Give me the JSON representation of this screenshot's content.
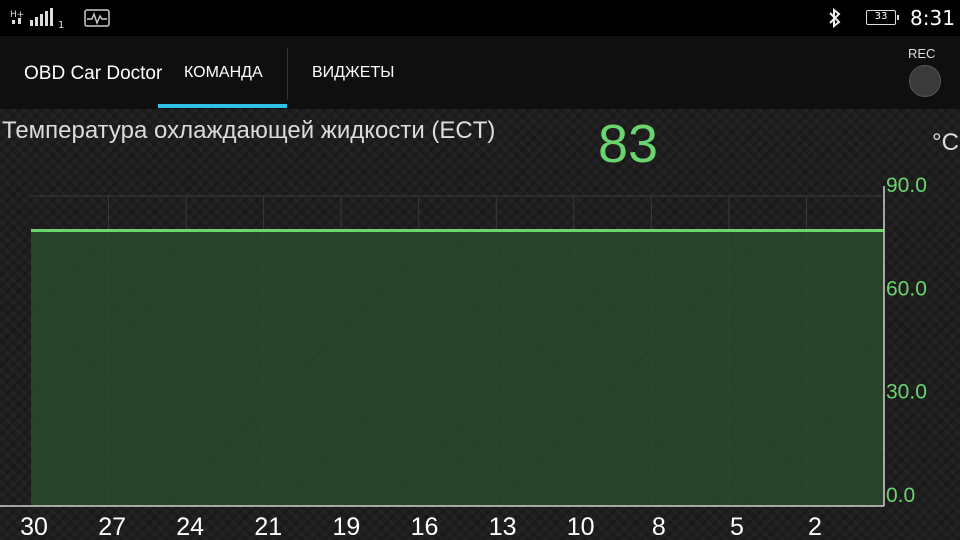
{
  "status_bar": {
    "signal_icon": "signal-bars-icon",
    "network_type": "H+",
    "sim_slot": "1",
    "notification_icon": "car-diagnostic-icon",
    "bluetooth_icon": "bluetooth-icon",
    "battery_level": "33",
    "time": "8:31"
  },
  "app_bar": {
    "title": "OBD Car Doctor",
    "tabs": [
      {
        "label": "КОМАНДА",
        "selected": true
      },
      {
        "label": "ВИДЖЕТЫ",
        "selected": false
      }
    ],
    "rec_label": "REC",
    "accent_color": "#2fc1e4"
  },
  "sensor": {
    "name": "Температура охлаждающей жидкости (ECT)",
    "value": "83",
    "unit": "°C",
    "value_color": "#6ad46e"
  },
  "chart_data": {
    "type": "area",
    "x": [
      30,
      27,
      24,
      21,
      19,
      16,
      13,
      10,
      8,
      5,
      2
    ],
    "x_tick_labels": [
      "30",
      "27",
      "24",
      "21",
      "19",
      "16",
      "13",
      "10",
      "8",
      "5",
      "2"
    ],
    "y_tick_labels": [
      "90.0",
      "60.0",
      "30.0",
      "0.0"
    ],
    "y_ticks": [
      90,
      60,
      30,
      0
    ],
    "series": [
      {
        "values": [
          80,
          80,
          80,
          80,
          80,
          80,
          80,
          80,
          80,
          80,
          80,
          80
        ],
        "color": "#6ad46e",
        "fill": "#2a4a2c"
      }
    ],
    "ylim": [
      0,
      90
    ],
    "y_axis_side": "right",
    "grid": true
  }
}
